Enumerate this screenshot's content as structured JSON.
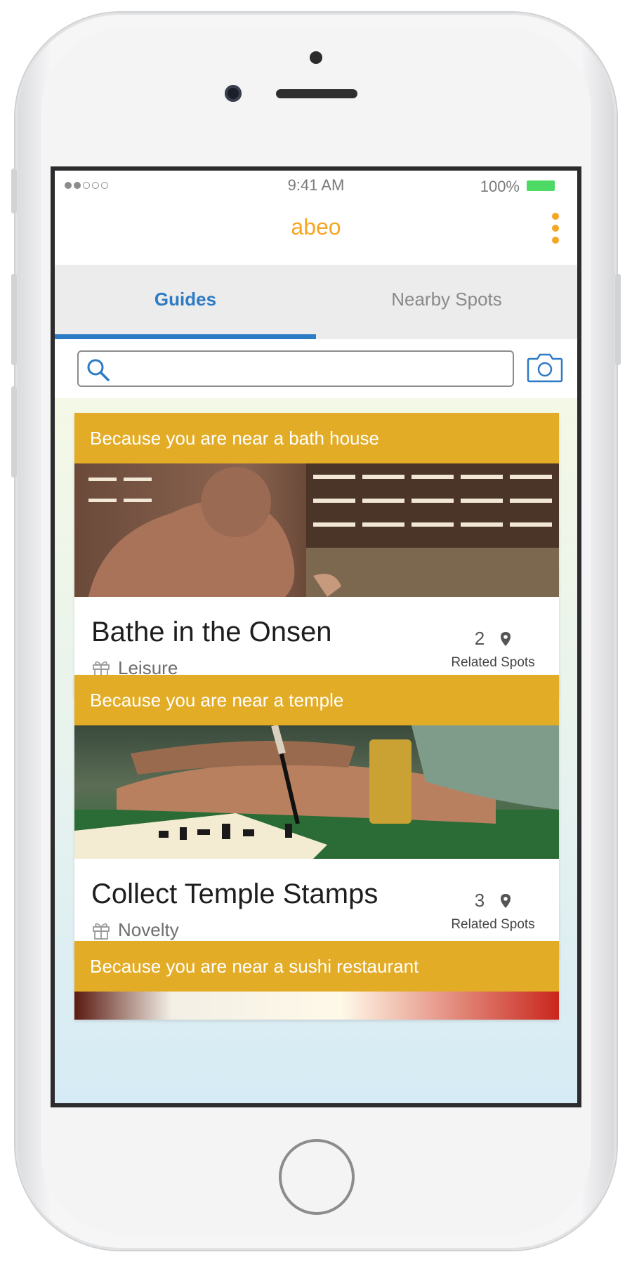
{
  "status_bar": {
    "time": "9:41 AM",
    "battery": "100%"
  },
  "app": {
    "title": "abeo"
  },
  "tabs": [
    {
      "label": "Guides",
      "active": true
    },
    {
      "label": "Nearby Spots",
      "active": false
    }
  ],
  "search": {
    "value": "",
    "placeholder": ""
  },
  "guides": [
    {
      "reason": "Because you are near a bath house",
      "title": "Bathe in the Onsen",
      "category": "Leisure",
      "related_count": "2",
      "related_label": "Related Spots"
    },
    {
      "reason": "Because you are near a temple",
      "title": "Collect Temple Stamps",
      "category": "Novelty",
      "related_count": "3",
      "related_label": "Related Spots"
    },
    {
      "reason": "Because you are near a sushi restaurant"
    }
  ],
  "colors": {
    "accent_orange": "#f5a623",
    "tab_blue": "#2d7bc4",
    "banner_gold": "#e3ac26"
  }
}
